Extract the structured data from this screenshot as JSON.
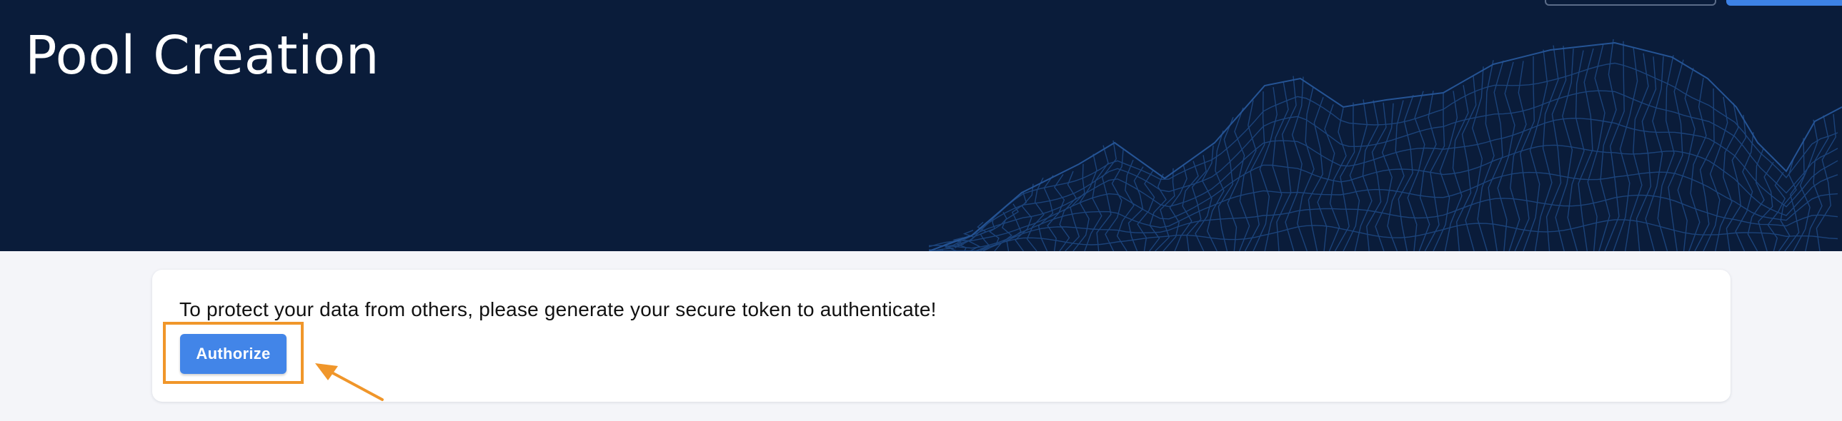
{
  "header": {
    "title": "Pool Creation"
  },
  "auth_card": {
    "message": "To protect your data from others, please generate your secure token to authenticate!",
    "authorize_label": "Authorize"
  },
  "colors": {
    "header_bg": "#0a1c3a",
    "primary_button": "#4285e8",
    "highlight": "#f0962a",
    "page_bg": "#f4f5f9"
  },
  "icons": {
    "annotation": "orange-arrow-icon",
    "background": "wireframe-mountain"
  }
}
